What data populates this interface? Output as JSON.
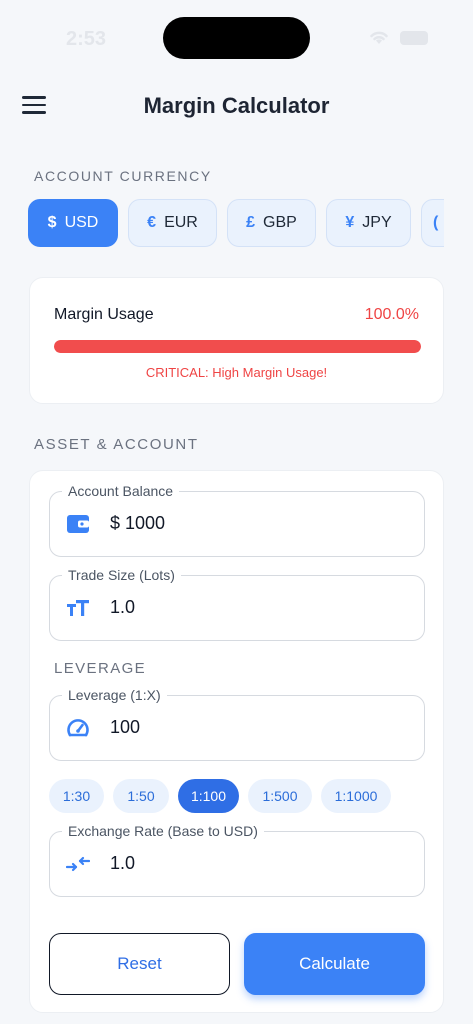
{
  "status_bar": {
    "time": "2:53"
  },
  "header": {
    "title": "Margin Calculator"
  },
  "account_currency": {
    "label": "ACCOUNT CURRENCY",
    "options": [
      {
        "symbol": "$",
        "code": "USD",
        "selected": true
      },
      {
        "symbol": "€",
        "code": "EUR",
        "selected": false
      },
      {
        "symbol": "£",
        "code": "GBP",
        "selected": false
      },
      {
        "symbol": "¥",
        "code": "JPY",
        "selected": false
      }
    ]
  },
  "margin": {
    "label": "Margin Usage",
    "value": "100.0%",
    "fill_fraction": 1.0,
    "warning": "CRITICAL: High Margin Usage!",
    "color": "#ef4444"
  },
  "asset_account": {
    "label": "ASSET & ACCOUNT",
    "account_balance": {
      "label": "Account Balance",
      "value": "$ 1000",
      "icon": "wallet-icon"
    },
    "trade_size": {
      "label": "Trade Size (Lots)",
      "value": "1.0",
      "icon": "text-size-icon"
    },
    "leverage_section_label": "LEVERAGE",
    "leverage": {
      "label": "Leverage (1:X)",
      "value": "100",
      "icon": "speedometer-icon"
    },
    "leverage_presets": [
      {
        "label": "1:30",
        "selected": false
      },
      {
        "label": "1:50",
        "selected": false
      },
      {
        "label": "1:100",
        "selected": true
      },
      {
        "label": "1:500",
        "selected": false
      },
      {
        "label": "1:1000",
        "selected": false
      }
    ],
    "exchange_rate": {
      "label": "Exchange Rate (Base to USD)",
      "value": "1.0",
      "icon": "swap-arrows-icon"
    }
  },
  "actions": {
    "reset_label": "Reset",
    "calculate_label": "Calculate"
  },
  "colors": {
    "accent": "#3b82f6",
    "danger": "#ef4444"
  }
}
